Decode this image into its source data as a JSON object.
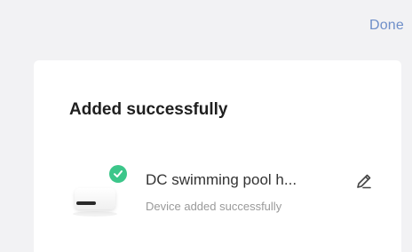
{
  "header": {
    "done_label": "Done"
  },
  "card": {
    "title": "Added successfully",
    "device": {
      "name": "DC swimming pool h...",
      "status": "Device added successfully",
      "badge_icon": "check-icon",
      "edit_icon": "pencil-icon"
    }
  },
  "colors": {
    "accent": "#6f8fc9",
    "success": "#3cc68a",
    "background": "#f2f2f4",
    "card": "#ffffff"
  }
}
